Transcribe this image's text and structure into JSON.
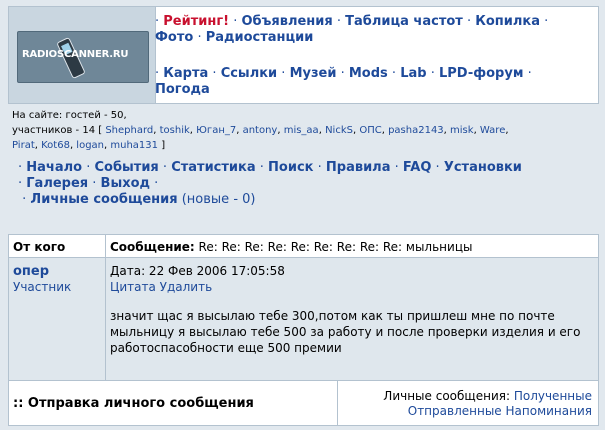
{
  "logo": {
    "text": "RADIOSCANNER.RU"
  },
  "top_menu": {
    "row1": [
      {
        "label": "Рейтинг!",
        "style": "rating"
      },
      {
        "label": "Объявления"
      },
      {
        "label": "Таблица частот"
      },
      {
        "label": "Копилка"
      },
      {
        "label": "Фото"
      },
      {
        "label": "Радиостанции"
      }
    ],
    "row2": [
      {
        "label": "Карта"
      },
      {
        "label": "Ссылки"
      },
      {
        "label": "Музей"
      },
      {
        "label": "Mods"
      },
      {
        "label": "Lab"
      },
      {
        "label": "LPD-форум"
      },
      {
        "label": "Погода"
      }
    ]
  },
  "online": {
    "prefix": "На сайте: гостей - 50,",
    "members_prefix": "участников - 14 [",
    "members": [
      "Shephard",
      "toshik",
      "Юган_7",
      "antony",
      "mis_aa",
      "NickS",
      "ОПС",
      "pasha2143",
      "misk",
      "Ware",
      "Pirat",
      "Kot68",
      "logan",
      "muha131"
    ],
    "suffix": "]"
  },
  "nav": {
    "items": [
      "Начало",
      "События",
      "Статистика",
      "Поиск",
      "Правила",
      "FAQ",
      "Установки",
      "Галерея",
      "Выход",
      "Личные сообщения"
    ],
    "new_count": "(новые - 0)"
  },
  "message": {
    "header_from": "От кого",
    "header_subject_label": "Сообщение:",
    "subject": "Re: Re: Re: Re: Re: Re: Re: Re: Re: мыльницы",
    "author": "опер",
    "role": "Участник",
    "date": "Дата: 22 Фев 2006 17:05:58",
    "quote_label": "Цитата",
    "delete_label": "Удалить",
    "text": "значит щас я высылаю тебе 300,потом как ты пришлеш мне по почте мыльницу я высылаю тебе 500 за работу и после проверки изделия и его работоспасобности еще 500 премии"
  },
  "bottom": {
    "title": ":: Отправка личного сообщения",
    "pm_label": "Личные сообщения:",
    "received": "Полученные",
    "sent": "Отправленные",
    "reminders": "Напоминания"
  }
}
